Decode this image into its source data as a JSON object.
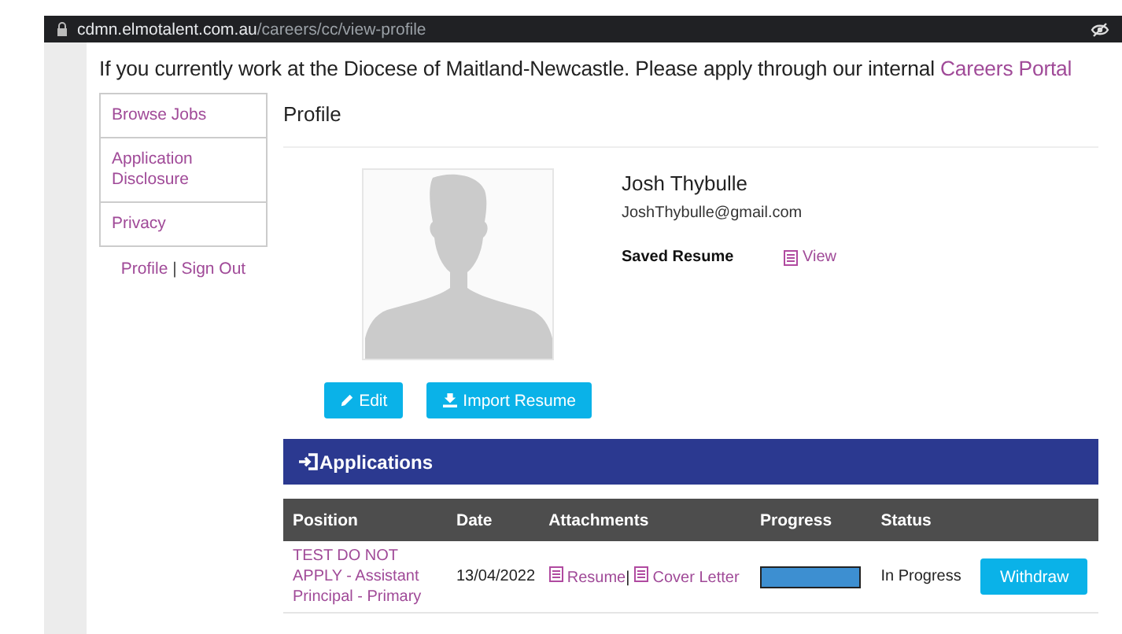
{
  "address_bar": {
    "domain": "cdmn.elmotalent.com.au",
    "path": "/careers/cc/view-profile"
  },
  "banner": {
    "text": "If you currently work at the Diocese of Maitland-Newcastle. Please apply through our internal",
    "link": "Careers Portal"
  },
  "sidebar": {
    "items": [
      {
        "label": "Browse Jobs"
      },
      {
        "label": "Application Disclosure"
      },
      {
        "label": "Privacy"
      }
    ],
    "footer": {
      "profile": "Profile",
      "separator": "|",
      "sign_out": "Sign Out"
    }
  },
  "profile": {
    "heading": "Profile",
    "name": "Josh Thybulle",
    "email": "JoshThybulle@gmail.com",
    "saved_resume_label": "Saved Resume",
    "view_link": "View",
    "buttons": [
      {
        "label": "Edit",
        "kind": "edit"
      },
      {
        "label": "Import Resume",
        "kind": "import"
      }
    ]
  },
  "applications": {
    "title": "Applications",
    "columns": [
      "Position",
      "Date",
      "Attachments",
      "Progress",
      "Status"
    ],
    "rows": [
      {
        "position": "TEST DO NOT APPLY - Assistant Principal - Primary",
        "date": "13/04/2022",
        "attachments": [
          "Resume",
          "Cover Letter"
        ],
        "separator": "|",
        "level": 1,
        "status": "In Progress",
        "action": "Withdraw"
      }
    ]
  }
}
